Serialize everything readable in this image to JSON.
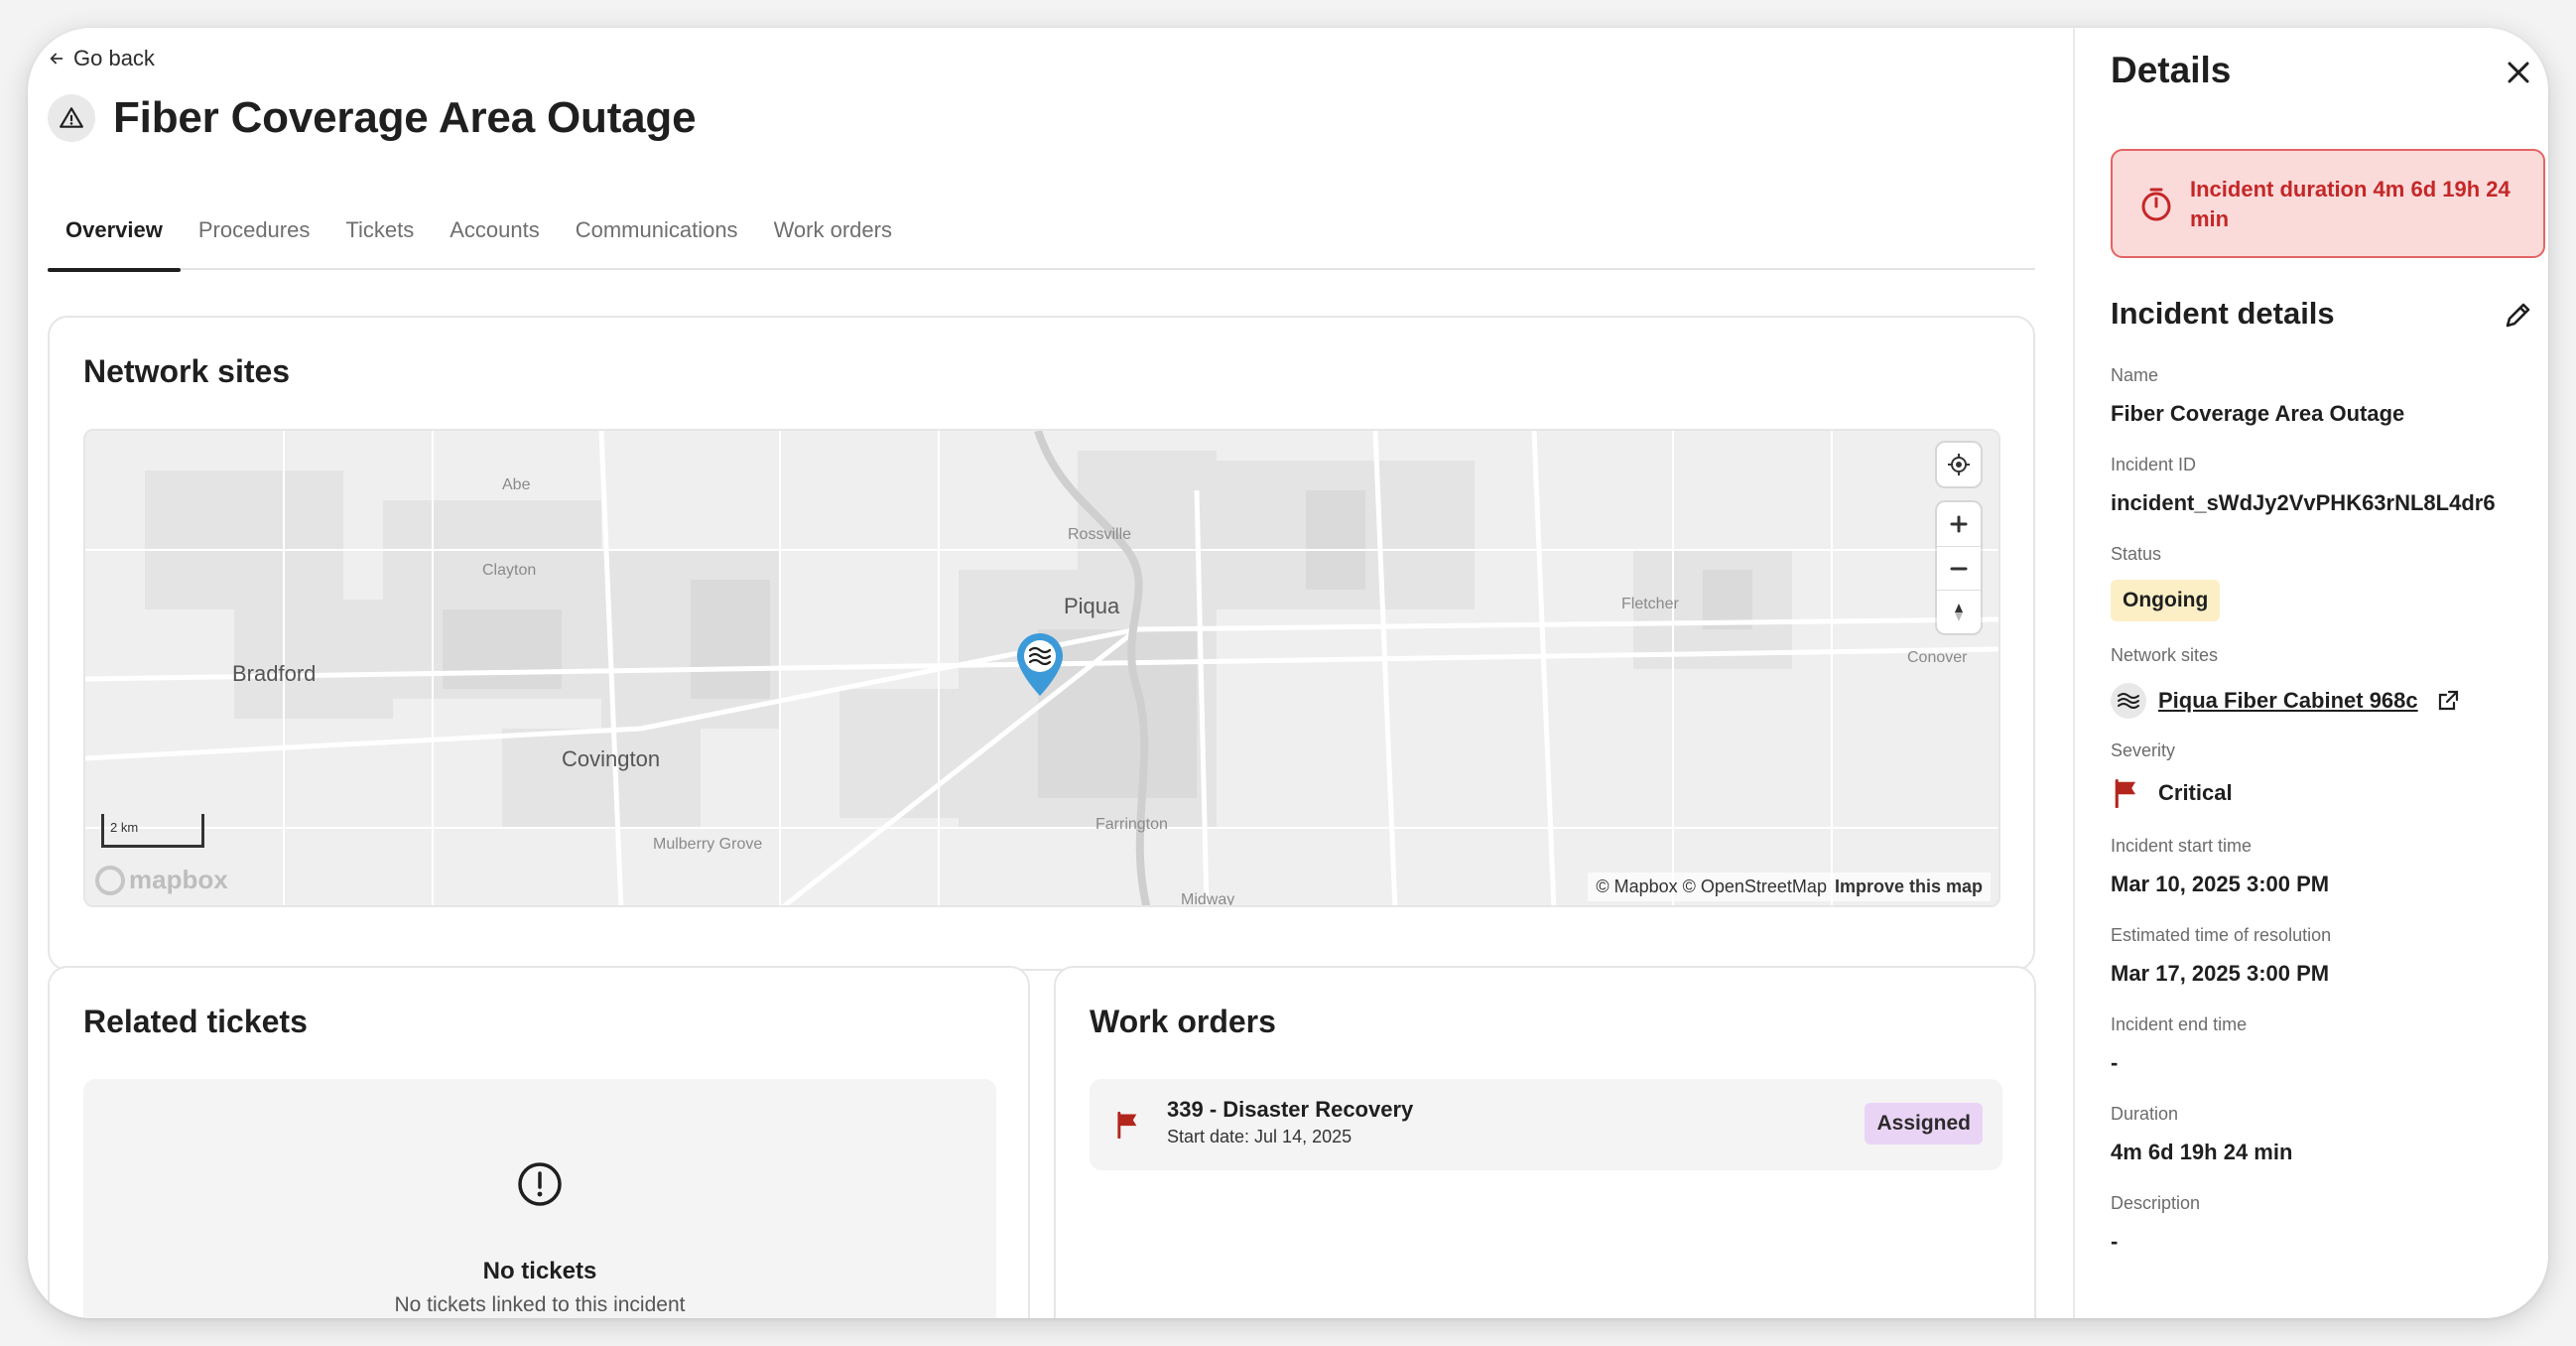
{
  "header": {
    "go_back": "Go back",
    "title": "Fiber Coverage Area Outage",
    "title_icon": "warning-triangle-icon"
  },
  "tabs": [
    {
      "label": "Overview",
      "active": true
    },
    {
      "label": "Procedures",
      "active": false
    },
    {
      "label": "Tickets",
      "active": false
    },
    {
      "label": "Accounts",
      "active": false
    },
    {
      "label": "Communications",
      "active": false
    },
    {
      "label": "Work orders",
      "active": false
    }
  ],
  "network_sites": {
    "title": "Network sites",
    "map": {
      "place_labels": [
        "Abe",
        "Clayton",
        "Rossville",
        "Piqua",
        "Fletcher",
        "Conover",
        "Bradford",
        "Covington",
        "Mulberry Grove",
        "Farrington",
        "Midway"
      ],
      "scale": "2 km",
      "logo": "mapbox",
      "attribution": "© Mapbox © OpenStreetMap",
      "improve": "Improve this map",
      "controls": [
        "locate-icon",
        "zoom-in-icon",
        "zoom-out-icon",
        "compass-icon"
      ]
    }
  },
  "related_tickets": {
    "title": "Related tickets",
    "empty_title": "No tickets",
    "empty_subtitle": "No tickets linked to this incident"
  },
  "work_orders": {
    "title": "Work orders",
    "items": [
      {
        "title": "339 - Disaster Recovery",
        "start": "Start date: Jul 14, 2025",
        "status": "Assigned"
      }
    ]
  },
  "details": {
    "title": "Details",
    "alert": "Incident duration 4m 6d 19h 24 min",
    "section_title": "Incident details",
    "fields": {
      "name_label": "Name",
      "name": "Fiber Coverage Area Outage",
      "id_label": "Incident ID",
      "id": "incident_sWdJy2VvPHK63rNL8L4dr6",
      "status_label": "Status",
      "status": "Ongoing",
      "sites_label": "Network sites",
      "site": "Piqua Fiber Cabinet 968c",
      "severity_label": "Severity",
      "severity": "Critical",
      "start_label": "Incident start time",
      "start": "Mar 10, 2025 3:00 PM",
      "eta_label": "Estimated time of resolution",
      "eta": "Mar 17, 2025 3:00 PM",
      "end_label": "Incident end time",
      "end": "-",
      "duration_label": "Duration",
      "duration": "4m 6d 19h 24 min",
      "description_label": "Description",
      "description": "-"
    }
  },
  "colors": {
    "alert_bg": "#fbdada",
    "alert_text": "#c42727",
    "status_ongoing": "#fcefc6",
    "badge_assigned": "#ead4f5",
    "flag_critical": "#b3261e",
    "pin": "#3d9ad9"
  }
}
